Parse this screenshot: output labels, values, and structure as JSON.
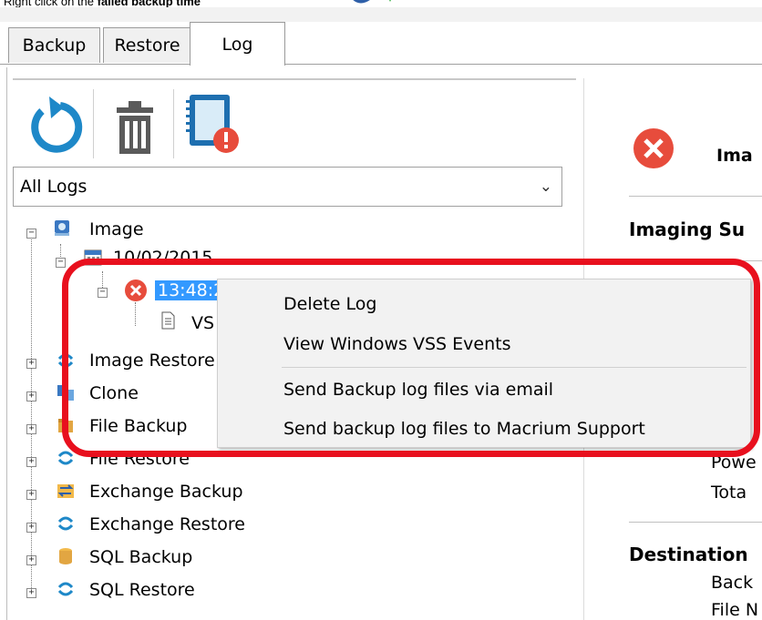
{
  "caption": {
    "prefix": "Right click on the ",
    "bold": "failed backup time"
  },
  "tabs": [
    "Backup",
    "Restore",
    "Log"
  ],
  "toolbar": {
    "refresh": "refresh-icon",
    "delete": "trash-icon",
    "log": "log-error-icon"
  },
  "filter": {
    "value": "All Logs",
    "chevron": "⌄"
  },
  "tree": {
    "image": "Image",
    "date": "10/02/2015",
    "time": "13:48:2",
    "vss": "VS",
    "items": [
      "Image Restore",
      "Clone",
      "File Backup",
      "File Restore",
      "Exchange Backup",
      "Exchange Restore",
      "SQL Backup",
      "SQL Restore"
    ]
  },
  "context_menu": {
    "items": [
      "Delete Log",
      "View Windows VSS Events",
      "Send Backup log files via email",
      "Send backup log files to Macrium Support"
    ]
  },
  "right_panel": {
    "header": "Ima",
    "summary_title": "Imaging Su",
    "lines": [
      "Powe",
      "Tota"
    ],
    "dest_title": "Destination",
    "dest_lines": [
      "Back",
      "File N"
    ]
  },
  "colors": {
    "error": "#e74c3c",
    "highlight": "#e8101e",
    "selection": "#3399ff",
    "accent": "#1e88c8"
  }
}
